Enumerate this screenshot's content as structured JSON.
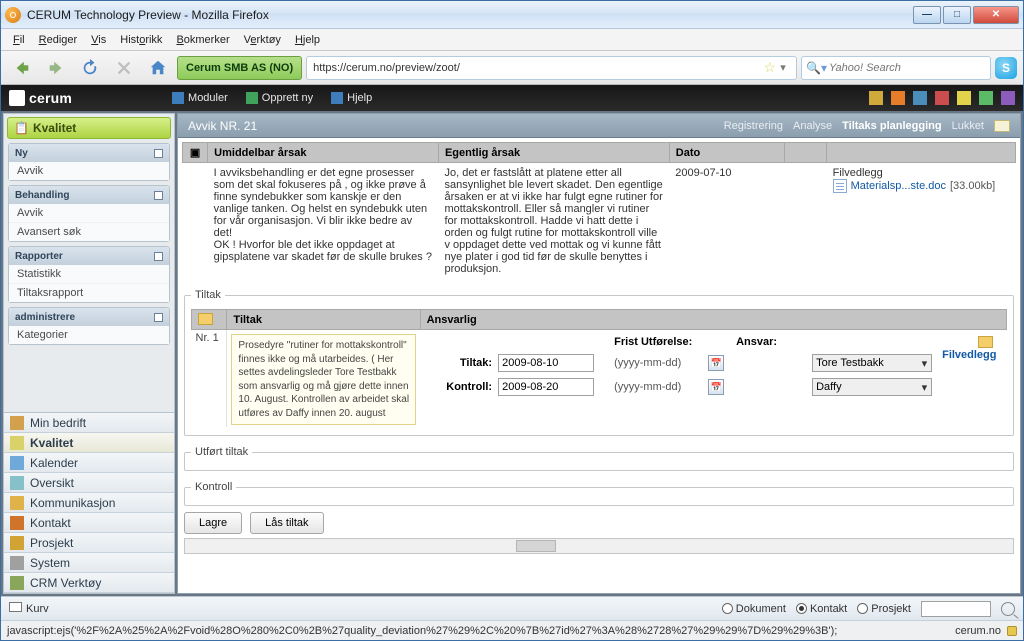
{
  "window": {
    "title": "CERUM Technology Preview - Mozilla Firefox"
  },
  "menubar": [
    "Fil",
    "Rediger",
    "Vis",
    "Historikk",
    "Bokmerker",
    "Verktøy",
    "Hjelp"
  ],
  "nav": {
    "site_badge": "Cerum SMB AS (NO)",
    "url": "https://cerum.no/preview/zoot/",
    "search_placeholder": "Yahoo! Search"
  },
  "cerum": {
    "brand": "cerum",
    "links": {
      "moduler": "Moduler",
      "opprett": "Opprett ny",
      "hjelp": "Hjelp"
    }
  },
  "sidebar": {
    "title": "Kvalitet",
    "sections": [
      {
        "title": "Ny",
        "items": [
          "Avvik"
        ]
      },
      {
        "title": "Behandling",
        "items": [
          "Avvik",
          "Avansert søk"
        ]
      },
      {
        "title": "Rapporter",
        "items": [
          "Statistikk",
          "Tiltaksrapport"
        ]
      },
      {
        "title": "administrere",
        "items": [
          "Kategorier"
        ]
      }
    ],
    "mainnav": [
      "Min bedrift",
      "Kvalitet",
      "Kalender",
      "Oversikt",
      "Kommunikasjon",
      "Kontakt",
      "Prosjekt",
      "System",
      "CRM Verktøy"
    ]
  },
  "page": {
    "title": "Avvik NR. 21",
    "tabs": [
      "Registrering",
      "Analyse",
      "Tiltaks planlegging",
      "Lukket"
    ],
    "active_tab": "Tiltaks planlegging"
  },
  "analysis": {
    "headers": {
      "umiddelbar": "Umiddelbar årsak",
      "egentlig": "Egentlig årsak",
      "dato": "Dato"
    },
    "umiddelbar": "I avviksbehandling er det egne prosesser som det skal fokuseres på , og ikke prøve å finne syndebukker som kanskje er den vanlige tanken. Og helst en syndebukk uten for vår organisasjon. Vi blir ikke bedre av det!\nOK ! Hvorfor ble det ikke oppdaget at gipsplatene var skadet før de skulle brukes ?",
    "egentlig": "Jo, det er fastslått at platene etter all sansynlighet ble levert skadet. Den egentlige årsaken er at vi ikke har fulgt egne rutiner for mottakskontroll. Eller så mangler vi rutiner for mottakskontroll. Hadde vi hatt dette i orden og fulgt rutine for mottakskontroll ville v oppdaget dette ved mottak og vi kunne fått nye plater i god tid før de skulle benyttes i produksjon.",
    "dato": "2009-07-10",
    "attachment": {
      "header": "Filvedlegg",
      "file": "Materialsp...ste.doc",
      "size": "[33.00kb]"
    }
  },
  "tiltak": {
    "legend": "Tiltak",
    "headers": {
      "tiltak": "Tiltak",
      "ansvarlig": "Ansvarlig"
    },
    "rowid": "Nr. 1",
    "description": "Prosedyre \"rutiner for mottakskontroll\" finnes ikke og må utarbeides. ( Her settes avdelingsleder Tore Testbakk som ansvarlig og må gjøre dette innen 10. August. Kontrollen av arbeidet skal utføres av Daffy innen 20. august",
    "dates": {
      "header_frist": "Frist Utførelse:",
      "header_ansvar": "Ansvar:",
      "row1": {
        "label": "Tiltak:",
        "date": "2009-08-10",
        "hint": "(yyyy-mm-dd)",
        "ansvar": "Tore Testbakk"
      },
      "row2": {
        "label": "Kontroll:",
        "date": "2009-08-20",
        "hint": "(yyyy-mm-dd)",
        "ansvar": "Daffy"
      }
    },
    "attachment_label": "Filvedlegg",
    "utfort_legend": "Utført tiltak",
    "kontroll_legend": "Kontroll",
    "buttons": {
      "lagre": "Lagre",
      "las": "Lås tiltak"
    }
  },
  "statusbar": {
    "kurv": "Kurv",
    "radios": {
      "dokument": "Dokument",
      "kontakt": "Kontakt",
      "prosjekt": "Prosjekt"
    }
  },
  "bottom": {
    "js": "javascript:ejs('%2F%2A%25%2A%2Fvoid%28O%280%2C0%2B%27quality_deviation%27%29%2C%20%7B%27id%27%3A%28%2728%27%29%29%7D%29%29%3B');",
    "domain": "cerum.no"
  }
}
